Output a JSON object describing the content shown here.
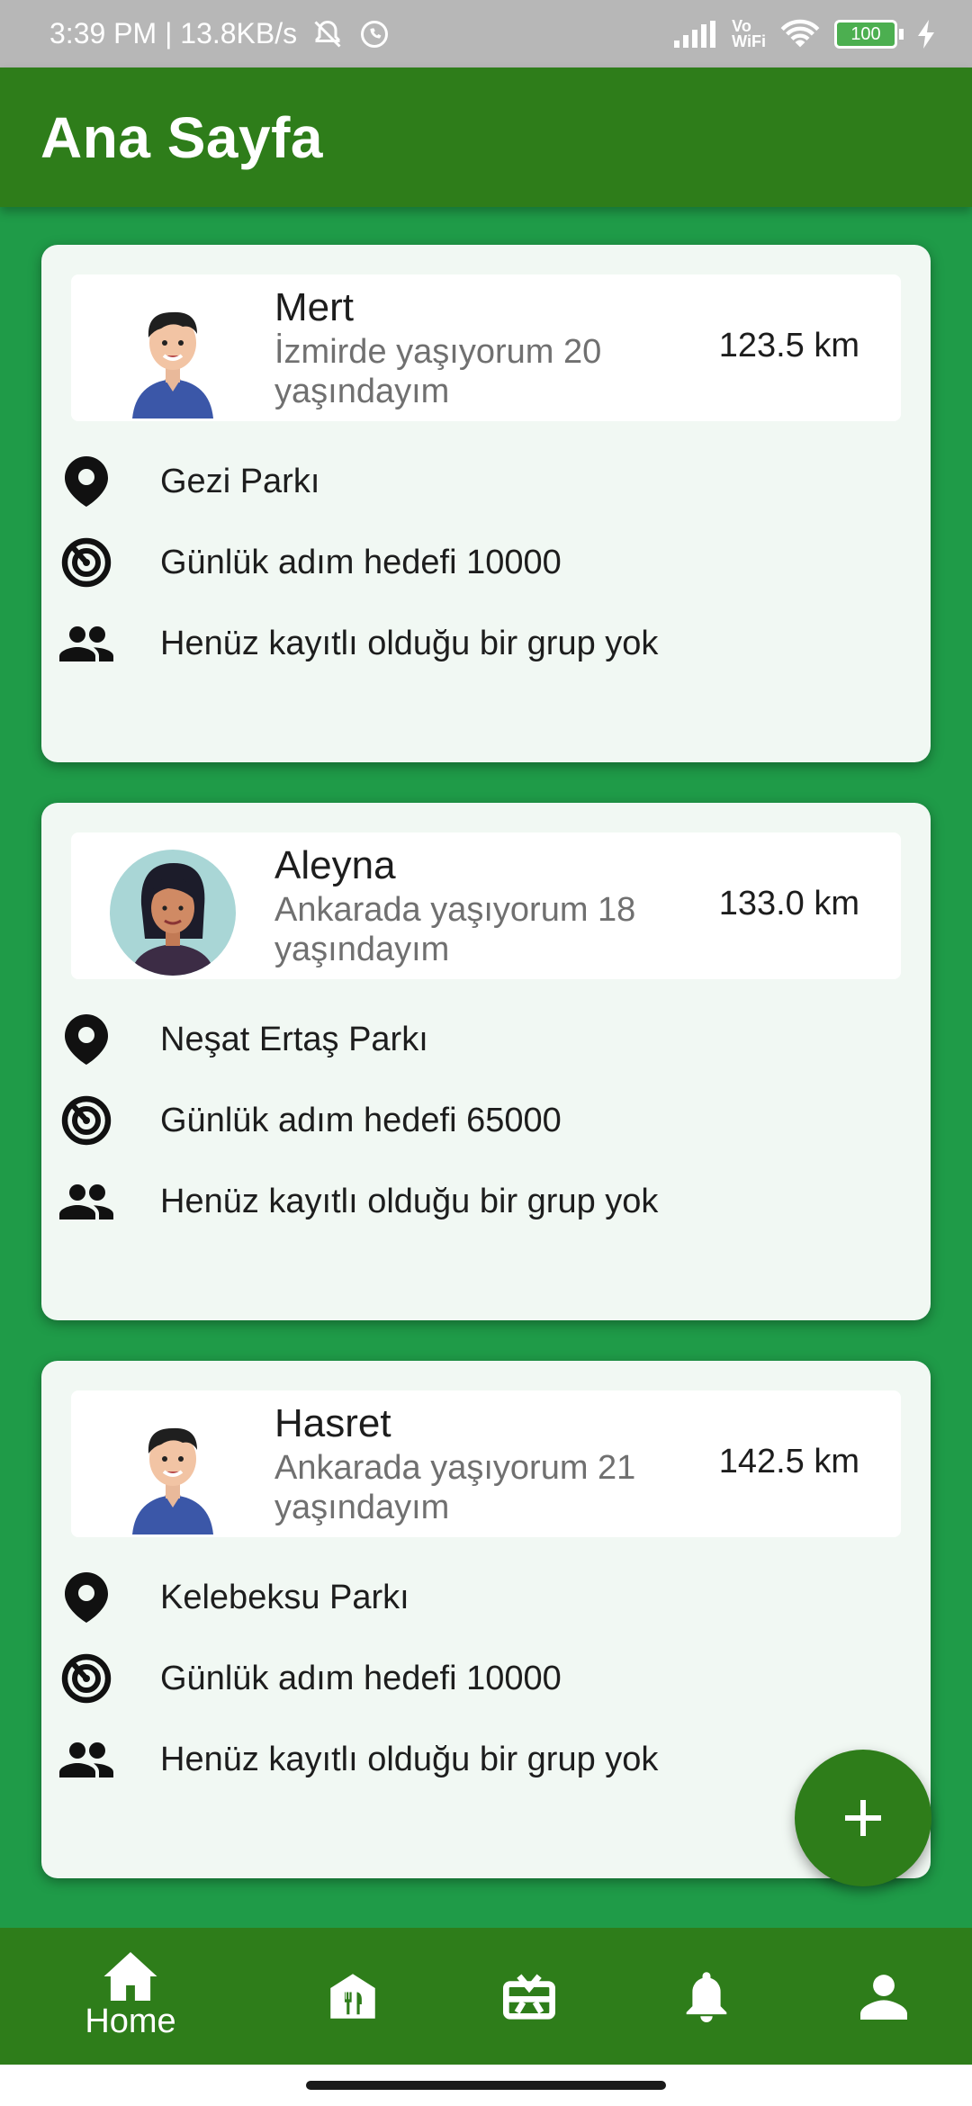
{
  "status_bar": {
    "time_network": "3:39 PM | 13.8KB/s",
    "vowifi": "Vo\nWiFi",
    "battery": "100"
  },
  "app_bar": {
    "title": "Ana Sayfa"
  },
  "cards": [
    {
      "name": "Mert",
      "bio": "İzmirde yaşıyorum 20 yaşındayım",
      "distance": "123.5 km",
      "park": "Gezi Parkı",
      "step_goal": "Günlük adım hedefi 10000",
      "group": "Henüz kayıtlı olduğu bir grup yok",
      "avatar": "male-avatar"
    },
    {
      "name": "Aleyna",
      "bio": "Ankarada yaşıyorum 18 yaşındayım",
      "distance": "133.0 km",
      "park": "Neşat Ertaş Parkı",
      "step_goal": "Günlük adım hedefi 65000",
      "group": "Henüz kayıtlı olduğu bir grup yok",
      "avatar": "female-avatar"
    },
    {
      "name": "Hasret",
      "bio": "Ankarada yaşıyorum 21 yaşındayım",
      "distance": "142.5 km",
      "park": "Kelebeksu Parkı",
      "step_goal": "Günlük adım hedefi 10000",
      "group": "Henüz kayıtlı olduğu bir grup yok",
      "avatar": "male-avatar"
    }
  ],
  "bottom_nav": {
    "items": [
      {
        "icon": "home-icon",
        "label": "Home"
      },
      {
        "icon": "restaurant-icon",
        "label": ""
      },
      {
        "icon": "gift-card-icon",
        "label": ""
      },
      {
        "icon": "bell-icon",
        "label": ""
      },
      {
        "icon": "person-icon",
        "label": ""
      }
    ]
  },
  "colors": {
    "background": "#1f9b48",
    "primary": "#2e7d1a",
    "card": "#f1f8f3"
  }
}
